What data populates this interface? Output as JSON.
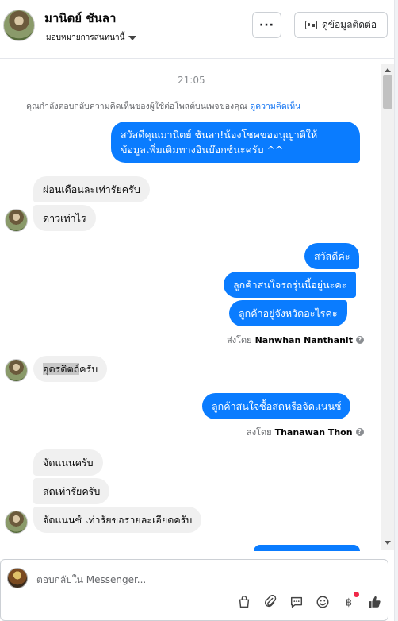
{
  "header": {
    "contact_name": "มานิตย์ ชันลา",
    "assign_label": "มอบหมายการสนทนานี้",
    "more_label": "···",
    "view_contact_label": "ดูข้อมูลติดต่อ"
  },
  "thread": {
    "time": "21:05",
    "context_text": "คุณกำลังตอบกลับความคิดเห็นของผู้ใช้ต่อโพสต์บนเพจของคุณ",
    "context_link": "ดูความคิดเห็น",
    "messages": [
      {
        "line1": "สวัสดีคุณมานิตย์ ชันลา!น้องโชคขออนุญาติให้",
        "line2": "ข้อมูลเพิ่มเติมทางอินบ๊อกซ์นะครับ ^^"
      },
      {
        "text": "ผ่อนเดือนละเท่ารัยครับ"
      },
      {
        "text": "ดาวเท่าไร"
      },
      {
        "text": "สวัสดีค่ะ"
      },
      {
        "text": "ลูกค้าสนใจรถรุ่นนี้อยู่นะคะ"
      },
      {
        "text": "ลูกค้าอยู่จังหวัดอะไรคะ"
      },
      {
        "text_highlight": "อุตรดิตถ์",
        "text_rest": "ครับ"
      },
      {
        "text": "ลูกค้าสนใจซื้อสดหรือจัดแนนซ์"
      },
      {
        "text": "จัดแนนครับ"
      },
      {
        "text": "สดเท่ารัยครับ"
      },
      {
        "text": "จัดแนนซ์ เท่ารัยขอรายละเอียดครับ"
      }
    ],
    "sent_by_1": {
      "prefix": "ส่งโดย",
      "name": "Nanwhan Nanthanit"
    },
    "sent_by_2": {
      "prefix": "ส่งโดย",
      "name": "Thanawan Thon"
    }
  },
  "composer": {
    "placeholder": "ตอบกลับใน Messenger...",
    "tools": [
      "shopping-bag-icon",
      "attachment-icon",
      "saved-reply-icon",
      "emoji-icon",
      "baht-payment-icon",
      "like-icon"
    ]
  },
  "colors": {
    "outgoing_bubble": "#0a7cff",
    "incoming_bubble": "#f0f0f0",
    "link": "#1877f2"
  }
}
